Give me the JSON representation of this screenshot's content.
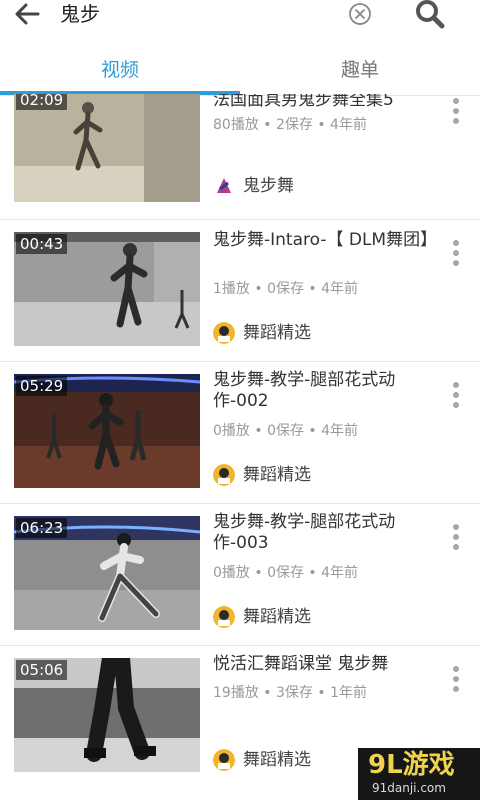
{
  "search": {
    "query": "鬼步"
  },
  "icons": {
    "back": "back-arrow-icon",
    "clear": "clear-circle-x-icon",
    "search": "search-icon",
    "more": "more-vertical-icon"
  },
  "tabs": [
    {
      "label": "视频",
      "active": true
    },
    {
      "label": "趣单",
      "active": false
    }
  ],
  "colors": {
    "accent": "#2e9ed8",
    "meta": "#9a9a9a",
    "title": "#333333"
  },
  "videos": [
    {
      "duration": "02:09",
      "title": "法国面具男鬼步舞全集5",
      "meta": "80播放 • 2保存 • 4年前",
      "channel": "鬼步舞"
    },
    {
      "duration": "00:43",
      "title": "鬼步舞-Intaro-【 DLM舞团】",
      "meta": "1播放 • 0保存 • 4年前",
      "channel": "舞蹈精选"
    },
    {
      "duration": "05:29",
      "title": "鬼步舞-教学-腿部花式动作-002",
      "meta": "0播放 • 0保存 • 4年前",
      "channel": "舞蹈精选"
    },
    {
      "duration": "06:23",
      "title": "鬼步舞-教学-腿部花式动作-003",
      "meta": "0播放 • 0保存 • 4年前",
      "channel": "舞蹈精选"
    },
    {
      "duration": "05:06",
      "title": "悦活汇舞蹈课堂 鬼步舞",
      "meta": "19播放 • 3保存 • 1年前",
      "channel": "舞蹈精选"
    }
  ],
  "watermark": {
    "logo": "9L游戏",
    "url": "91danji.com"
  }
}
